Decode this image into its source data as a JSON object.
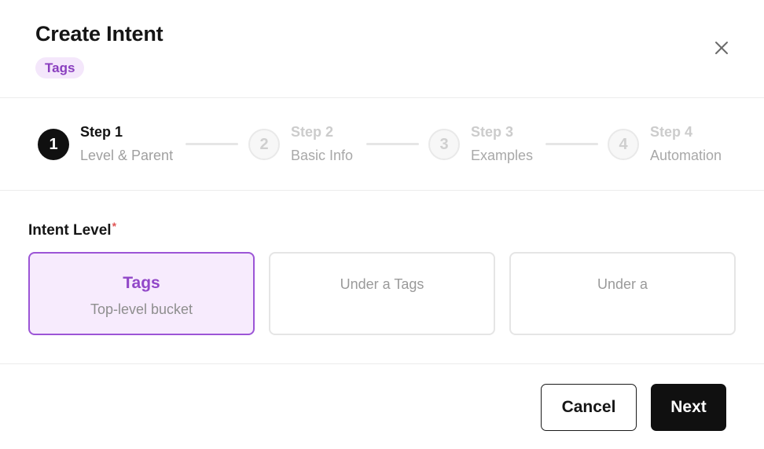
{
  "dialog": {
    "title": "Create Intent",
    "badge": "Tags"
  },
  "icons": {
    "close": "close-icon"
  },
  "stepper": {
    "steps": [
      {
        "number": "1",
        "title": "Step 1",
        "subtitle": "Level & Parent",
        "state": "active"
      },
      {
        "number": "2",
        "title": "Step 2",
        "subtitle": "Basic Info",
        "state": "inactive"
      },
      {
        "number": "3",
        "title": "Step 3",
        "subtitle": "Examples",
        "state": "inactive"
      },
      {
        "number": "4",
        "title": "Step 4",
        "subtitle": "Automation",
        "state": "inactive"
      }
    ]
  },
  "form": {
    "intent_level_label": "Intent Level",
    "required_marker": "*",
    "options": [
      {
        "title": "Tags",
        "subtitle": "Top-level bucket",
        "selected": true
      },
      {
        "title": "Under a Tags",
        "selected": false
      },
      {
        "title": "Under a",
        "selected": false
      }
    ]
  },
  "footer": {
    "cancel_label": "Cancel",
    "next_label": "Next"
  },
  "colors": {
    "accent": "#9147c8",
    "accent_bg": "#f7ebfd",
    "primary_button": "#101010",
    "required": "#e05555"
  }
}
